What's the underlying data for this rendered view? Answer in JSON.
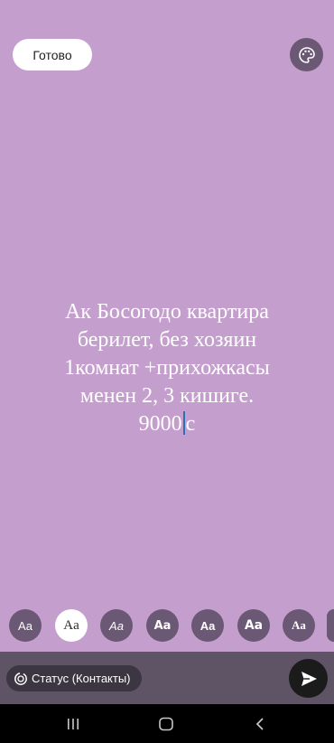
{
  "header": {
    "done_label": "Готово",
    "palette_icon": "palette-icon"
  },
  "story": {
    "text_lines": [
      "Ак Босогодо квартира",
      "берилет, без хозяин",
      "1комнат +прихожкасы",
      "менен 2, 3 кишиге."
    ],
    "last_line_before_cursor": "9000",
    "last_line_after_cursor": "с",
    "background_color": "#c49fcd",
    "text_color": "#ffffff"
  },
  "font_options": [
    {
      "label": "Aa",
      "style": "sans-regular"
    },
    {
      "label": "Aa",
      "style": "serif",
      "selected": true
    },
    {
      "label": "Aa",
      "style": "italic"
    },
    {
      "label": "Aa",
      "style": "rounded-bold"
    },
    {
      "label": "Aa",
      "style": "bold"
    },
    {
      "label": "Aa",
      "style": "heavy"
    },
    {
      "label": "Aa",
      "style": "serif-bold"
    },
    {
      "label": "Aa",
      "style": "more"
    }
  ],
  "footer": {
    "status_audience_label": "Статус (Контакты)",
    "status_icon": "status-ring-icon",
    "send_icon": "send-icon"
  },
  "system_nav": {
    "recents_icon": "recents-icon",
    "home_icon": "home-icon",
    "back_icon": "back-icon"
  }
}
